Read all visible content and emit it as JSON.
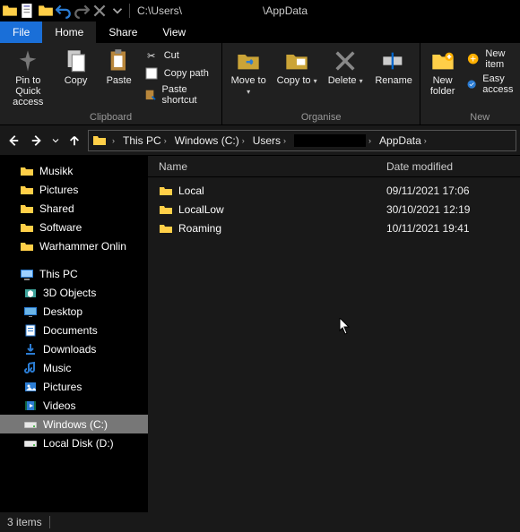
{
  "titlebar": {
    "path_prefix": "C:\\Users\\",
    "path_suffix": "\\AppData"
  },
  "tabs": {
    "file": "File",
    "home": "Home",
    "share": "Share",
    "view": "View"
  },
  "ribbon": {
    "pin": "Pin to Quick access",
    "copy": "Copy",
    "paste": "Paste",
    "cut": "Cut",
    "copy_path": "Copy path",
    "paste_shortcut": "Paste shortcut",
    "clipboard": "Clipboard",
    "move_to": "Move to",
    "copy_to": "Copy to",
    "delete": "Delete",
    "rename": "Rename",
    "organise": "Organise",
    "new_folder": "New folder",
    "new_item": "New item",
    "easy_access": "Easy access",
    "new": "New"
  },
  "breadcrumb": [
    "This PC",
    "Windows (C:)",
    "Users",
    "",
    "AppData"
  ],
  "columns": {
    "name": "Name",
    "date": "Date modified"
  },
  "files": [
    {
      "name": "Local",
      "date": "09/11/2021 17:06"
    },
    {
      "name": "LocalLow",
      "date": "30/10/2021 12:19"
    },
    {
      "name": "Roaming",
      "date": "10/11/2021 19:41"
    }
  ],
  "sidebar": {
    "quick": [
      "Musikk",
      "Pictures",
      "Shared",
      "Software",
      "Warhammer Onlin"
    ],
    "this_pc": "This PC",
    "pc_items": [
      {
        "label": "3D Objects",
        "icon": "3d"
      },
      {
        "label": "Desktop",
        "icon": "desktop"
      },
      {
        "label": "Documents",
        "icon": "documents"
      },
      {
        "label": "Downloads",
        "icon": "downloads"
      },
      {
        "label": "Music",
        "icon": "music"
      },
      {
        "label": "Pictures",
        "icon": "pictures"
      },
      {
        "label": "Videos",
        "icon": "videos"
      },
      {
        "label": "Windows (C:)",
        "icon": "drive",
        "selected": true
      },
      {
        "label": "Local Disk (D:)",
        "icon": "drive"
      }
    ]
  },
  "status": {
    "items": "3 items"
  }
}
